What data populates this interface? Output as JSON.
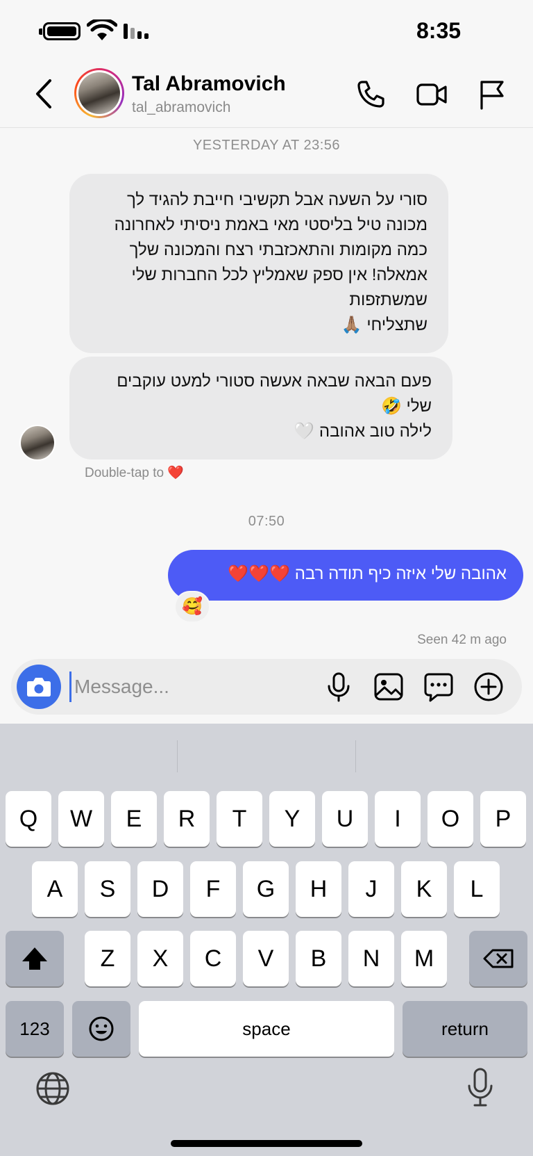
{
  "status_bar": {
    "time": "8:35"
  },
  "header": {
    "contact_name": "Tal Abramovich",
    "contact_handle": "tal_abramovich",
    "icons": [
      "back-chevron-icon",
      "phone-icon",
      "video-camera-icon",
      "flag-icon"
    ]
  },
  "chat": {
    "timestamp_1": "YESTERDAY AT 23:56",
    "incoming_1_lines": [
      "סורי על השעה אבל תקשיבי חייבת להגיד לך",
      "מכונה טיל בליסטי מאי באמת ניסיתי לאחרונה",
      "כמה מקומות והתאכזבתי רצח והמכונה שלך",
      "אמאלה! אין ספק שאמליץ לכל החברות שלי",
      "שמשתזפות",
      "שתצליחי 🙏🏽"
    ],
    "incoming_2_lines": [
      "פעם הבאה שבאה אעשה סטורי למעט עוקבים",
      "שלי 🤣",
      "לילה טוב אהובה 🤍"
    ],
    "double_tap_text": "Double-tap to",
    "double_tap_emoji": "❤️",
    "timestamp_2": "07:50",
    "outgoing_1": "אהובה שלי איזה כיף תודה רבה ❤️❤️❤️",
    "reaction_emoji": "🥰",
    "seen_text": "Seen 42 m ago"
  },
  "composer": {
    "placeholder": "Message...",
    "icons": [
      "camera-icon",
      "microphone-icon",
      "gallery-icon",
      "sticker-chat-icon",
      "plus-circle-icon"
    ]
  },
  "keyboard": {
    "row1": [
      "Q",
      "W",
      "E",
      "R",
      "T",
      "Y",
      "U",
      "I",
      "O",
      "P"
    ],
    "row2": [
      "A",
      "S",
      "D",
      "F",
      "G",
      "H",
      "J",
      "K",
      "L"
    ],
    "row3": [
      "Z",
      "X",
      "C",
      "V",
      "B",
      "N",
      "M"
    ],
    "numbers_label": "123",
    "space_label": "space",
    "return_label": "return"
  },
  "colors": {
    "outgoing_bubble": "#4d5bf6",
    "incoming_bubble": "#e9e9ea",
    "camera_button": "#3c6ee8",
    "keyboard_bg": "#d1d3d9"
  }
}
